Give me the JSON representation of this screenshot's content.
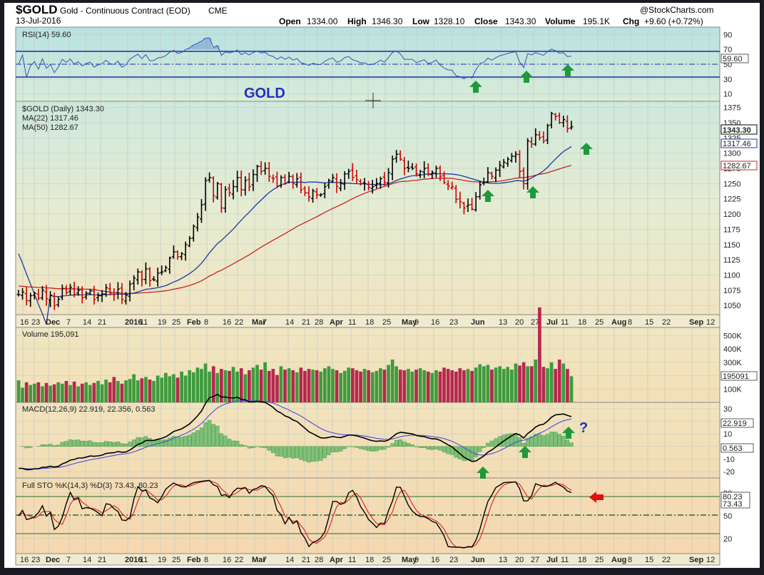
{
  "header": {
    "symbol": "$GOLD",
    "name": "Gold - Continuous Contract (EOD)",
    "exchange": "CME",
    "date": "13-Jul-2016",
    "source": "@StockCharts.com",
    "open_label": "Open",
    "open": "1334.00",
    "high_label": "High",
    "high": "1346.30",
    "low_label": "Low",
    "low": "1328.10",
    "close_label": "Close",
    "close": "1343.30",
    "volume_label": "Volume",
    "volume": "195.1K",
    "chg_label": "Chg",
    "chg": "+9.60 (+0.72%)"
  },
  "annotations": {
    "gold_label": "GOLD",
    "question_mark": "?"
  },
  "colors": {
    "up": "#000000",
    "down": "#cc0000",
    "ma22": "#1f3a9e",
    "ma50": "#cc2222",
    "vol_up": "#3e9b3e",
    "vol_down": "#b5294f",
    "arrow_green": "#1e9a3a",
    "arrow_red": "#e01010"
  },
  "chart_data": [
    {
      "type": "line",
      "title": "RSI(14) 59.60",
      "series": [
        {
          "name": "RSI(14)",
          "last": 59.6
        }
      ],
      "yticks": [
        "90",
        "70",
        "50",
        "30",
        "10"
      ],
      "ylim": [
        0,
        100
      ],
      "levels": [
        70,
        30
      ],
      "last_label": "59.60"
    },
    {
      "type": "candlestick",
      "title": "$GOLD (Daily) 1343.30",
      "series": [
        {
          "name": "MA(22) 1317.46",
          "last": 1317.46
        },
        {
          "name": "MA(50) 1282.67",
          "last": 1282.67
        }
      ],
      "ylim": [
        1035,
        1385
      ],
      "yticks": [
        "1375",
        "1350",
        "1325",
        "1300",
        "1275",
        "1250",
        "1225",
        "1200",
        "1175",
        "1150",
        "1125",
        "1100",
        "1075",
        "1050"
      ],
      "last_labels": [
        "1343.30",
        "1317.46",
        "1282.67"
      ],
      "xticks": [
        "16",
        "23",
        "Dec",
        "7",
        "14",
        "21",
        "2016",
        "11",
        "19",
        "25",
        "Feb",
        "8",
        "16",
        "22",
        "Mar",
        "7",
        "14",
        "21",
        "28",
        "Apr",
        "11",
        "18",
        "25",
        "May",
        "9",
        "16",
        "23",
        "Jun",
        "13",
        "20",
        "27",
        "Jul",
        "11",
        "18",
        "25",
        "Aug",
        "8",
        "15",
        "22",
        "Sep",
        "12"
      ],
      "closes": [
        1068,
        1072,
        1058,
        1066,
        1070,
        1062,
        1075,
        1061,
        1067,
        1050,
        1060,
        1078,
        1071,
        1080,
        1068,
        1075,
        1063,
        1070,
        1074,
        1060,
        1066,
        1069,
        1079,
        1070,
        1068,
        1077,
        1060,
        1067,
        1085,
        1095,
        1105,
        1093,
        1110,
        1091,
        1092,
        1103,
        1105,
        1112,
        1128,
        1138,
        1130,
        1135,
        1150,
        1160,
        1180,
        1195,
        1215,
        1255,
        1260,
        1230,
        1250,
        1210,
        1240,
        1235,
        1245,
        1260,
        1240,
        1255,
        1245,
        1265,
        1278,
        1270,
        1275,
        1262,
        1258,
        1246,
        1260,
        1250,
        1262,
        1250,
        1258,
        1240,
        1235,
        1228,
        1238,
        1232,
        1232,
        1245,
        1255,
        1260,
        1245,
        1250,
        1266,
        1270,
        1260,
        1256,
        1250,
        1250,
        1244,
        1245,
        1250,
        1258,
        1252,
        1268,
        1290,
        1298,
        1290,
        1275,
        1275,
        1275,
        1266,
        1270,
        1275,
        1265,
        1268,
        1275,
        1262,
        1252,
        1246,
        1245,
        1224,
        1220,
        1210,
        1215,
        1208,
        1228,
        1248,
        1252,
        1268,
        1262,
        1272,
        1280,
        1285,
        1290,
        1295,
        1298,
        1270,
        1250,
        1320,
        1315,
        1330,
        1325,
        1320,
        1345,
        1365,
        1360,
        1350,
        1355,
        1340,
        1343.3
      ],
      "markers": [
        "up arrows under Jun, Jun 27 and Jul lows"
      ]
    },
    {
      "type": "bar",
      "title": "Volume 195,091",
      "yticks": [
        "500K",
        "400K",
        "300K",
        "200K",
        "100K"
      ],
      "ylim": [
        0,
        560
      ],
      "last_label": "195091",
      "values": [
        165,
        110,
        150,
        130,
        140,
        150,
        120,
        145,
        125,
        135,
        150,
        140,
        160,
        130,
        155,
        120,
        140,
        150,
        130,
        145,
        160,
        135,
        170,
        150,
        190,
        160,
        140,
        165,
        175,
        210,
        165,
        180,
        190,
        170,
        160,
        200,
        185,
        220,
        195,
        210,
        185,
        230,
        200,
        240,
        225,
        260,
        250,
        290,
        230,
        270,
        220,
        250,
        240,
        235,
        265,
        230,
        255,
        210,
        240,
        260,
        280,
        245,
        300,
        235,
        250,
        205,
        270,
        245,
        255,
        240,
        225,
        260,
        235,
        250,
        245,
        240,
        230,
        255,
        270,
        250,
        240,
        220,
        235,
        260,
        255,
        240,
        230,
        250,
        240,
        225,
        235,
        255,
        245,
        280,
        320,
        270,
        245,
        240,
        250,
        230,
        245,
        255,
        240,
        230,
        220,
        240,
        230,
        260,
        250,
        240,
        230,
        255,
        240,
        250,
        235,
        260,
        285,
        270,
        280,
        245,
        260,
        270,
        250,
        265,
        245,
        290,
        275,
        300,
        270,
        270,
        320,
        710,
        265,
        255,
        300,
        250,
        320,
        290,
        250,
        195
      ],
      "colors_up_down": "green=up, red=down"
    },
    {
      "type": "line",
      "title": "MACD(12,26,9) 22.919, 22.356, 0.563",
      "series": [
        {
          "name": "MACD",
          "last": 22.919
        },
        {
          "name": "Signal",
          "last": 22.356
        },
        {
          "name": "Histogram",
          "last": 0.563
        }
      ],
      "yticks": [
        "30",
        "20",
        "10",
        "0",
        "-10",
        "-20"
      ],
      "ylim": [
        -25,
        35
      ],
      "last_labels": [
        "22.919",
        "0.563"
      ]
    },
    {
      "type": "line",
      "title": "Full STO %K(14,3) %D(3) 73.43, 80.23",
      "series": [
        {
          "name": "%K",
          "last": 73.43
        },
        {
          "name": "%D",
          "last": 80.23
        }
      ],
      "yticks": [
        "80",
        "50",
        "20"
      ],
      "ylim": [
        0,
        100
      ],
      "last_labels": [
        "80.23",
        "73.43"
      ]
    }
  ]
}
